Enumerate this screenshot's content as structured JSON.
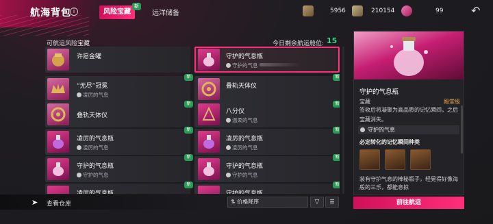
{
  "header": {
    "title": "航海背包",
    "info": "i",
    "tabs": [
      {
        "label": "风险宝藏",
        "badge": "新",
        "active": true
      },
      {
        "label": "远洋储备"
      }
    ],
    "resources": [
      {
        "icon": "ore-icon",
        "value": "5956"
      },
      {
        "icon": "coin-icon",
        "value": "210154"
      },
      {
        "icon": "gem-icon",
        "value": "99"
      }
    ]
  },
  "list": {
    "section_label": "可航运风险宝藏",
    "slots_label": "今日剩余航运舱位:",
    "slots_value": "15",
    "items": [
      {
        "name": "许愿金罐",
        "sub": "",
        "new": false
      },
      {
        "name": "守护的气息瓶",
        "sub": "守护的气息",
        "new": false,
        "selected": true
      },
      {
        "name": "“无尽”冠冕",
        "sub": "凌厉的气息",
        "new": true
      },
      {
        "name": "叠轨天体仪",
        "sub": "",
        "new": true
      },
      {
        "name": "叠轨天体仪",
        "sub": "",
        "new": true
      },
      {
        "name": "八分仪",
        "sub": "温柔的气息",
        "new": true
      },
      {
        "name": "凌厉的气息瓶",
        "sub": "凌厉的气息",
        "new": true
      },
      {
        "name": "凌厉的气息瓶",
        "sub": "凌厉的气息",
        "new": true
      },
      {
        "name": "守护的气息瓶",
        "sub": "守护的气息",
        "new": true
      },
      {
        "name": "守护的气息瓶",
        "sub": "守护的气息",
        "new": true
      },
      {
        "name": "凌厉的气息瓶",
        "sub": "",
        "new": true
      },
      {
        "name": "守护的气息瓶",
        "sub": "",
        "new": true
      }
    ]
  },
  "footer": {
    "view_warehouse": "查看仓库",
    "sort_label": "价格降序",
    "filter_icon": "filter-icon",
    "sort_icon": "sort-icon"
  },
  "detail": {
    "name": "守护的气息瓶",
    "type": "宝藏",
    "rarity": "殿堂级",
    "description": "签收后将凝聚为高品质的记忆瞬间，之后宝藏消失。",
    "attribute": "守护的气息",
    "section_title": "必定转化的记忆瞬间种类",
    "footer_text": "装有守护气息的棒秘瓶子，轻晃得好像海般的三乐，都能息掠",
    "button_label": "前往航运"
  }
}
